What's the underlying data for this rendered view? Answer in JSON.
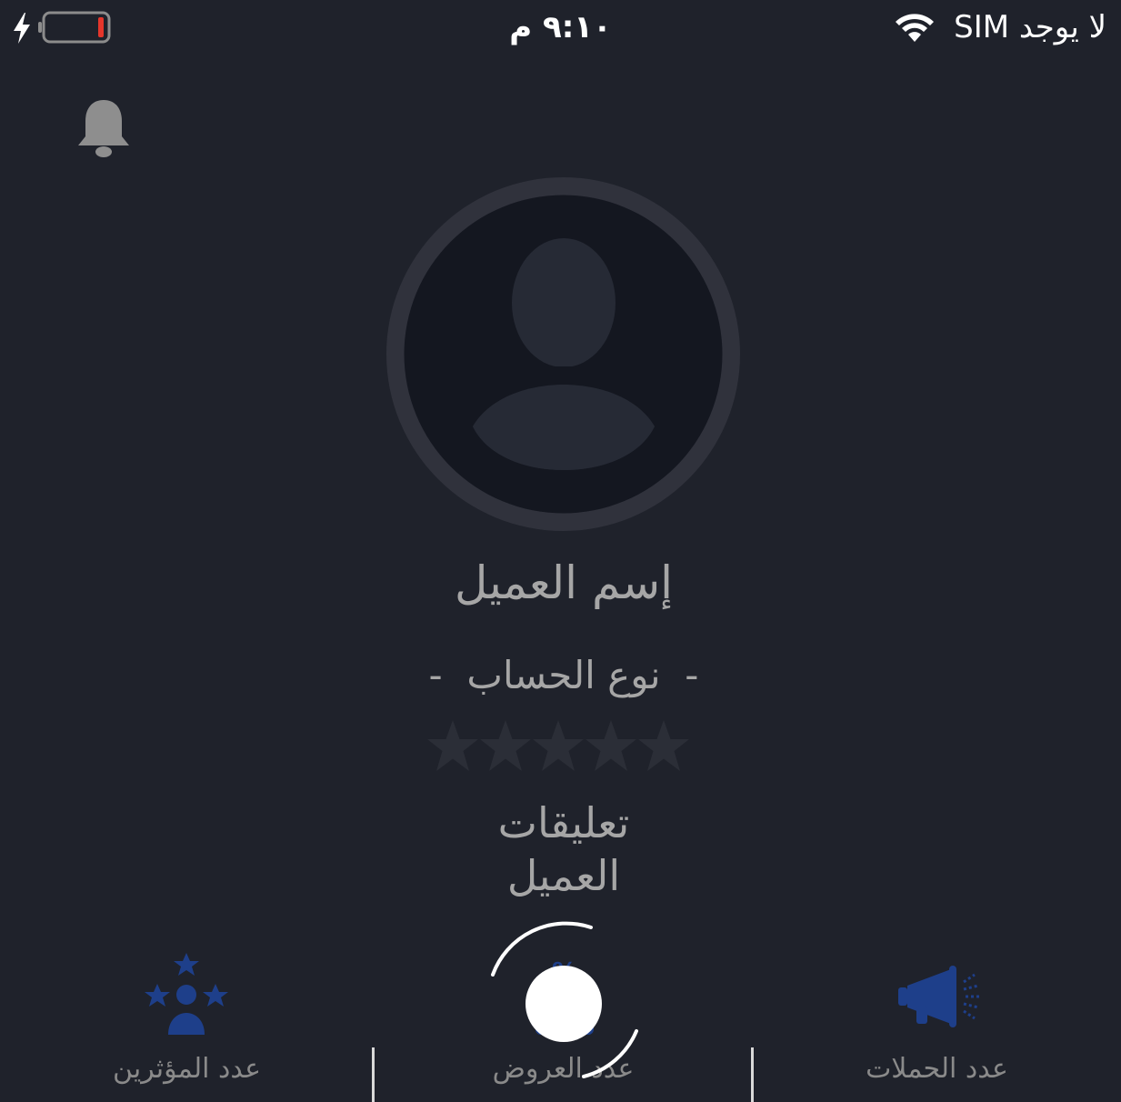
{
  "status_bar": {
    "carrier": "لا يوجد SIM",
    "time": "٩:١٠ م",
    "battery_level": 0.08,
    "charging": true,
    "icons": [
      "wifi-icon",
      "charging-bolt-icon",
      "battery-icon"
    ]
  },
  "header": {
    "notification_icon": "bell-icon"
  },
  "profile": {
    "avatar_icon": "default-user-avatar-icon",
    "customer_name": "إسم العميل",
    "account_type": "-  نوع الحساب  -",
    "rating": {
      "stars_filled": 0,
      "stars_total": 5
    },
    "comments_line1": "تعليقات",
    "comments_line2": "العميل"
  },
  "stats": {
    "campaigns_label": "عدد الحملات",
    "campaigns_icon": "megaphone-icon",
    "offers_label": "عدد العروض",
    "offers_icon": "offers-icon",
    "influencers_label": "عدد المؤثرين",
    "influencers_icon": "influencers-icon"
  },
  "loading": {
    "icon": "loading-spinner-icon",
    "visible": true
  },
  "colors": {
    "background": "#1f222b",
    "accent_blue": "#1e3f8a",
    "text_muted": "#a6a6a6",
    "battery_low": "#e5362b"
  }
}
